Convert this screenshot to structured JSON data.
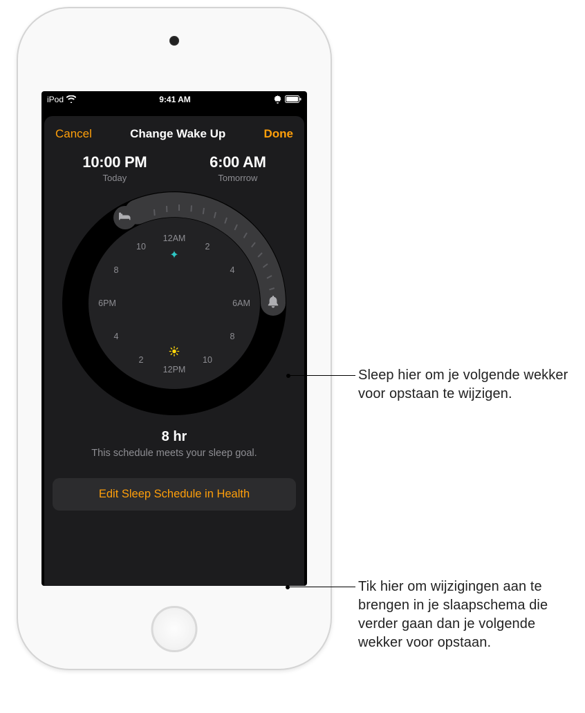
{
  "statusBar": {
    "carrier": "iPod",
    "time": "9:41 AM"
  },
  "nav": {
    "cancel": "Cancel",
    "title": "Change Wake Up",
    "done": "Done"
  },
  "times": {
    "bedTime": "10:00 PM",
    "bedDay": "Today",
    "wakeTime": "6:00 AM",
    "wakeDay": "Tomorrow"
  },
  "dial": {
    "labels": {
      "top": "12AM",
      "bottom": "12PM",
      "left": "6PM",
      "right": "6AM",
      "n2": "2",
      "n4": "4",
      "n8": "8",
      "n10": "10",
      "s2": "2",
      "s4": "4",
      "s8": "8",
      "s10": "10"
    }
  },
  "summary": {
    "duration": "8 hr",
    "message": "This schedule meets your sleep goal."
  },
  "editButton": "Edit Sleep Schedule in Health",
  "callouts": {
    "c1": "Sleep hier om je volgende wekker voor opstaan te wijzigen.",
    "c2": "Tik hier om wijzigingen aan te brengen in je slaapschema die verder gaan dan je volgende wekker voor opstaan."
  }
}
